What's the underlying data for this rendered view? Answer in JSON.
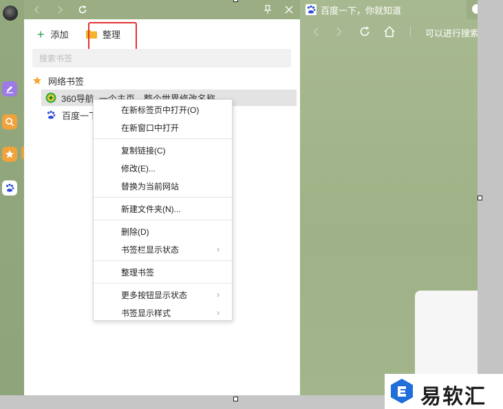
{
  "left_rail": {
    "avatar": "avatar",
    "buttons": [
      {
        "icon": "edit-icon",
        "color": "#8b6fe0"
      },
      {
        "icon": "search-icon",
        "color": "#f0a23c"
      },
      {
        "icon": "star-icon",
        "color": "#f0a23c"
      },
      {
        "icon": "baidu-paw-icon",
        "color": "#2a4ad8"
      }
    ]
  },
  "bookmark_panel": {
    "toolbar": {
      "add_label": "添加",
      "organize_label": "整理"
    },
    "search": {
      "placeholder": "搜索书签"
    },
    "tree": {
      "root_label": "网络书签",
      "items": [
        {
          "label": "360导航_一个主页，整个世界修改名称",
          "icon": "360-nav-icon"
        },
        {
          "label": "百度一下",
          "icon": "baidu-paw-icon"
        }
      ]
    }
  },
  "context_menu": {
    "items": [
      {
        "label": "在新标签页中打开(O)",
        "has_submenu": false
      },
      {
        "label": "在新窗口中打开",
        "has_submenu": false
      },
      {
        "label": "复制链接(C)",
        "has_submenu": false
      },
      {
        "label": "修改(E)...",
        "has_submenu": false
      },
      {
        "label": "替换为当前网站",
        "has_submenu": false
      },
      {
        "label": "新建文件夹(N)...",
        "has_submenu": false
      },
      {
        "label": "删除(D)",
        "has_submenu": false
      },
      {
        "label": "书签栏显示状态",
        "has_submenu": true
      },
      {
        "label": "整理书签",
        "has_submenu": false
      },
      {
        "label": "更多按钮显示状态",
        "has_submenu": true
      },
      {
        "label": "书签显示样式",
        "has_submenu": true
      }
    ]
  },
  "browser": {
    "tab_title": "百度一下，你就知道",
    "address_text": "可以进行搜索"
  },
  "watermark": {
    "text": "易软汇"
  },
  "colors": {
    "accent_green": "#2ba24c",
    "highlight_red": "#e0312f",
    "folder_yellow": "#f3b32a",
    "background_green": "#a6b78c"
  }
}
